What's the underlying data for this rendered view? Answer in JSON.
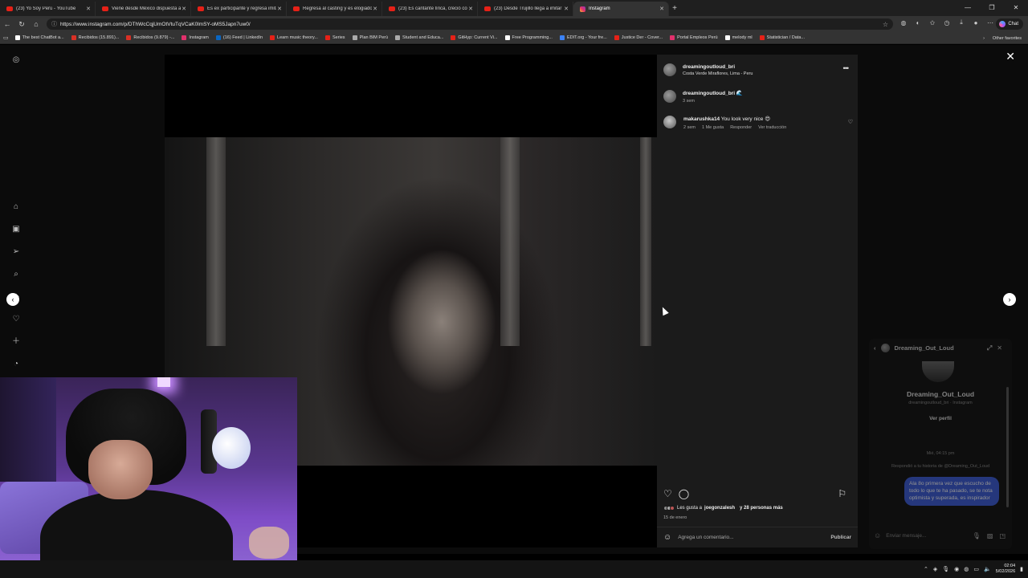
{
  "browser": {
    "tabs": [
      {
        "title": "(23) Yo Soy Perú - YouTube",
        "icon": "youtube-icon",
        "active": false
      },
      {
        "title": "Viene desde México dispuesta a d",
        "icon": "youtube-icon",
        "active": false
      },
      {
        "title": "Es ex participante y regresa imitan",
        "icon": "youtube-icon",
        "active": false
      },
      {
        "title": "Regresa al casting y es elogiado p",
        "icon": "youtube-icon",
        "active": false
      },
      {
        "title": "(23) Es cantante lírica, creció con e",
        "icon": "youtube-icon",
        "active": false
      },
      {
        "title": "(23) Desde Trujillo llega a imitar a",
        "icon": "youtube-icon",
        "active": false
      },
      {
        "title": "Instagram",
        "icon": "instagram-icon",
        "active": true
      }
    ],
    "new_tab": "+",
    "url": "https://www.instagram.com/p/DThWcCqjUmOtVtuTqVCaK0lmSY-oMS5Japn7uw0/",
    "chat_label": "Chat",
    "bookmarks": [
      {
        "label": "The best ChatBot a...",
        "color": "#ffffff"
      },
      {
        "label": "Recibidos (15.891)...",
        "color": "#d93025"
      },
      {
        "label": "Recibidos (9.879) -...",
        "color": "#d93025"
      },
      {
        "label": "Instagram",
        "color": "#e1306c"
      },
      {
        "label": "(16) Feed | LinkedIn",
        "color": "#0a66c2"
      },
      {
        "label": "Learn music theory...",
        "color": "#e62117"
      },
      {
        "label": "Series",
        "color": "#e62117"
      },
      {
        "label": "Plan BIM Perú",
        "color": "#aaaaaa"
      },
      {
        "label": "Student and Educa...",
        "color": "#aaaaaa"
      },
      {
        "label": "GitHyp: Current Vi...",
        "color": "#e62117"
      },
      {
        "label": "Free Programming...",
        "color": "#ffffff"
      },
      {
        "label": "EDIT.org - Your fre...",
        "color": "#3b82f6"
      },
      {
        "label": "Justice Der - Cover...",
        "color": "#e62117"
      },
      {
        "label": "Portal Empleos Perú",
        "color": "#e1306c"
      },
      {
        "label": "melody ml",
        "color": "#ffffff"
      },
      {
        "label": "Statistician / Data...",
        "color": "#e62117"
      }
    ],
    "other_favorites": "Other favorites"
  },
  "post": {
    "author": "dreamingoutloud_bri",
    "location": "Costa Verde Miraflores, Lima - Peru",
    "caption_author": "dreamingoutloud_bri",
    "caption_emoji": "🌊",
    "caption_time": "3 sem",
    "comment": {
      "user": "makarushka14",
      "text": "You look very nice 😍",
      "time": "2 sem",
      "likes": "1 Me gusta",
      "reply": "Responder",
      "translate": "Ver traducción"
    },
    "likes_prefix": "Les gusta a",
    "likes_user": "joegonzalesh",
    "likes_suffix": "y 28 personas más",
    "date": "15 de enero",
    "comment_placeholder": "Agrega un comentario...",
    "publish_label": "Publicar"
  },
  "dm": {
    "title": "Dreaming_Out_Loud",
    "name": "Dreaming_Out_Loud",
    "handle": "dreamingoutloud_bri · Instagram",
    "view_profile": "Ver perfil",
    "time": "Mié, 04:15 pm",
    "reply_note": "Respondió a tu historia de @Dreaming_Out_Loud",
    "message": "Ala 8o primera vez que escucho de todo lo que te ha pasado, se te nota optimista y superada, es inspirador",
    "input_placeholder": "Enviar mensaje..."
  },
  "taskbar": {
    "time": "02:04",
    "date": "5/02/2026"
  }
}
